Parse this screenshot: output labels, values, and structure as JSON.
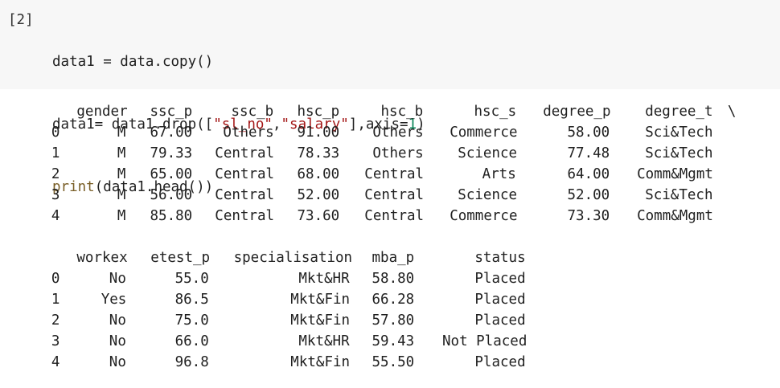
{
  "cell": {
    "prompt": "[2]",
    "code_lines": [
      [
        "data1 = data.copy()"
      ],
      [
        "data1= data1.drop([",
        "\"sl_no\"",
        ",",
        "\"salary\"",
        "],axis=",
        "1",
        ")"
      ],
      [
        "print",
        "(data1.head())"
      ]
    ]
  },
  "table1": {
    "index_header": "",
    "columns": [
      "gender",
      "ssc_p",
      "ssc_b",
      "hsc_p",
      "hsc_b",
      "hsc_s",
      "degree_p",
      "degree_t",
      "\\"
    ],
    "rows": [
      [
        "0",
        "M",
        "67.00",
        "Others",
        "91.00",
        "Others",
        "Commerce",
        "58.00",
        "Sci&Tech"
      ],
      [
        "1",
        "M",
        "79.33",
        "Central",
        "78.33",
        "Others",
        "Science",
        "77.48",
        "Sci&Tech"
      ],
      [
        "2",
        "M",
        "65.00",
        "Central",
        "68.00",
        "Central",
        "Arts",
        "64.00",
        "Comm&Mgmt"
      ],
      [
        "3",
        "M",
        "56.00",
        "Central",
        "52.00",
        "Central",
        "Science",
        "52.00",
        "Sci&Tech"
      ],
      [
        "4",
        "M",
        "85.80",
        "Central",
        "73.60",
        "Central",
        "Commerce",
        "73.30",
        "Comm&Mgmt"
      ]
    ]
  },
  "table2": {
    "columns": [
      "workex",
      "etest_p",
      "specialisation",
      "mba_p",
      "status"
    ],
    "rows": [
      [
        "0",
        "No",
        "55.0",
        "Mkt&HR",
        "58.80",
        "Placed"
      ],
      [
        "1",
        "Yes",
        "86.5",
        "Mkt&Fin",
        "66.28",
        "Placed"
      ],
      [
        "2",
        "No",
        "75.0",
        "Mkt&Fin",
        "57.80",
        "Placed"
      ],
      [
        "3",
        "No",
        "66.0",
        "Mkt&HR",
        "59.43",
        "Not Placed"
      ],
      [
        "4",
        "No",
        "96.8",
        "Mkt&Fin",
        "55.50",
        "Placed"
      ]
    ]
  },
  "colors": {
    "code_background": "#f7f7f7",
    "string": "#a31515",
    "number": "#098658",
    "function": "#795e26"
  }
}
